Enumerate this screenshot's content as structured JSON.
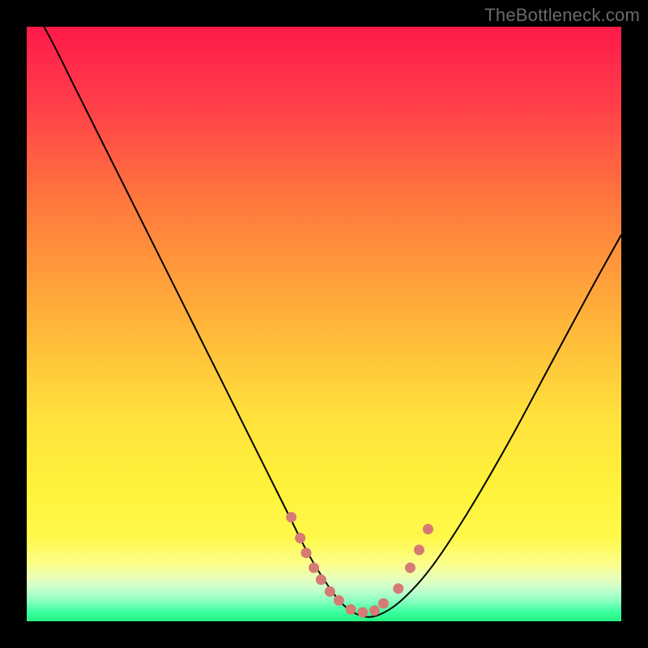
{
  "watermark": "TheBottleneck.com",
  "colors": {
    "frame": "#000000",
    "curve_stroke": "#000000",
    "dot_fill": "#d67a75",
    "gradient_stops": [
      {
        "offset": 0.0,
        "color": "#ff1a4a"
      },
      {
        "offset": 0.12,
        "color": "#ff3b4a"
      },
      {
        "offset": 0.3,
        "color": "#ff7a3d"
      },
      {
        "offset": 0.5,
        "color": "#ffb53a"
      },
      {
        "offset": 0.66,
        "color": "#ffe23c"
      },
      {
        "offset": 0.78,
        "color": "#fff23a"
      },
      {
        "offset": 0.86,
        "color": "#fff94b"
      },
      {
        "offset": 0.905,
        "color": "#fcfe8e"
      },
      {
        "offset": 0.925,
        "color": "#ebffb5"
      },
      {
        "offset": 0.945,
        "color": "#c9ffcd"
      },
      {
        "offset": 0.965,
        "color": "#8dffc2"
      },
      {
        "offset": 0.985,
        "color": "#37ff9e"
      },
      {
        "offset": 1.0,
        "color": "#25f07e"
      }
    ]
  },
  "chart_data": {
    "type": "line",
    "title": "",
    "xlabel": "",
    "ylabel": "",
    "xlim": [
      0,
      100
    ],
    "ylim": [
      0,
      100
    ],
    "series": [
      {
        "name": "bottleneck-curve",
        "x": [
          0,
          4,
          8,
          12,
          16,
          20,
          24,
          28,
          32,
          36,
          40,
          44,
          47,
          50,
          53,
          56,
          59,
          63,
          68,
          74,
          81,
          88,
          95,
          100
        ],
        "y": [
          105,
          98,
          90,
          82,
          74,
          66,
          58,
          50,
          42,
          34,
          26,
          18,
          12,
          7,
          3,
          1,
          1,
          3.5,
          9,
          18,
          30,
          43,
          56,
          65
        ]
      }
    ],
    "markers": {
      "name": "overlay-dots",
      "x": [
        44.5,
        46.0,
        47.0,
        48.3,
        49.5,
        51.0,
        52.5,
        54.5,
        56.5,
        58.5,
        60.0,
        62.5,
        64.5,
        66.0,
        67.5
      ],
      "y": [
        17.5,
        14.0,
        11.5,
        9.0,
        7.0,
        5.0,
        3.5,
        2.0,
        1.5,
        1.8,
        3.0,
        5.5,
        9.0,
        12.0,
        15.5
      ]
    }
  }
}
